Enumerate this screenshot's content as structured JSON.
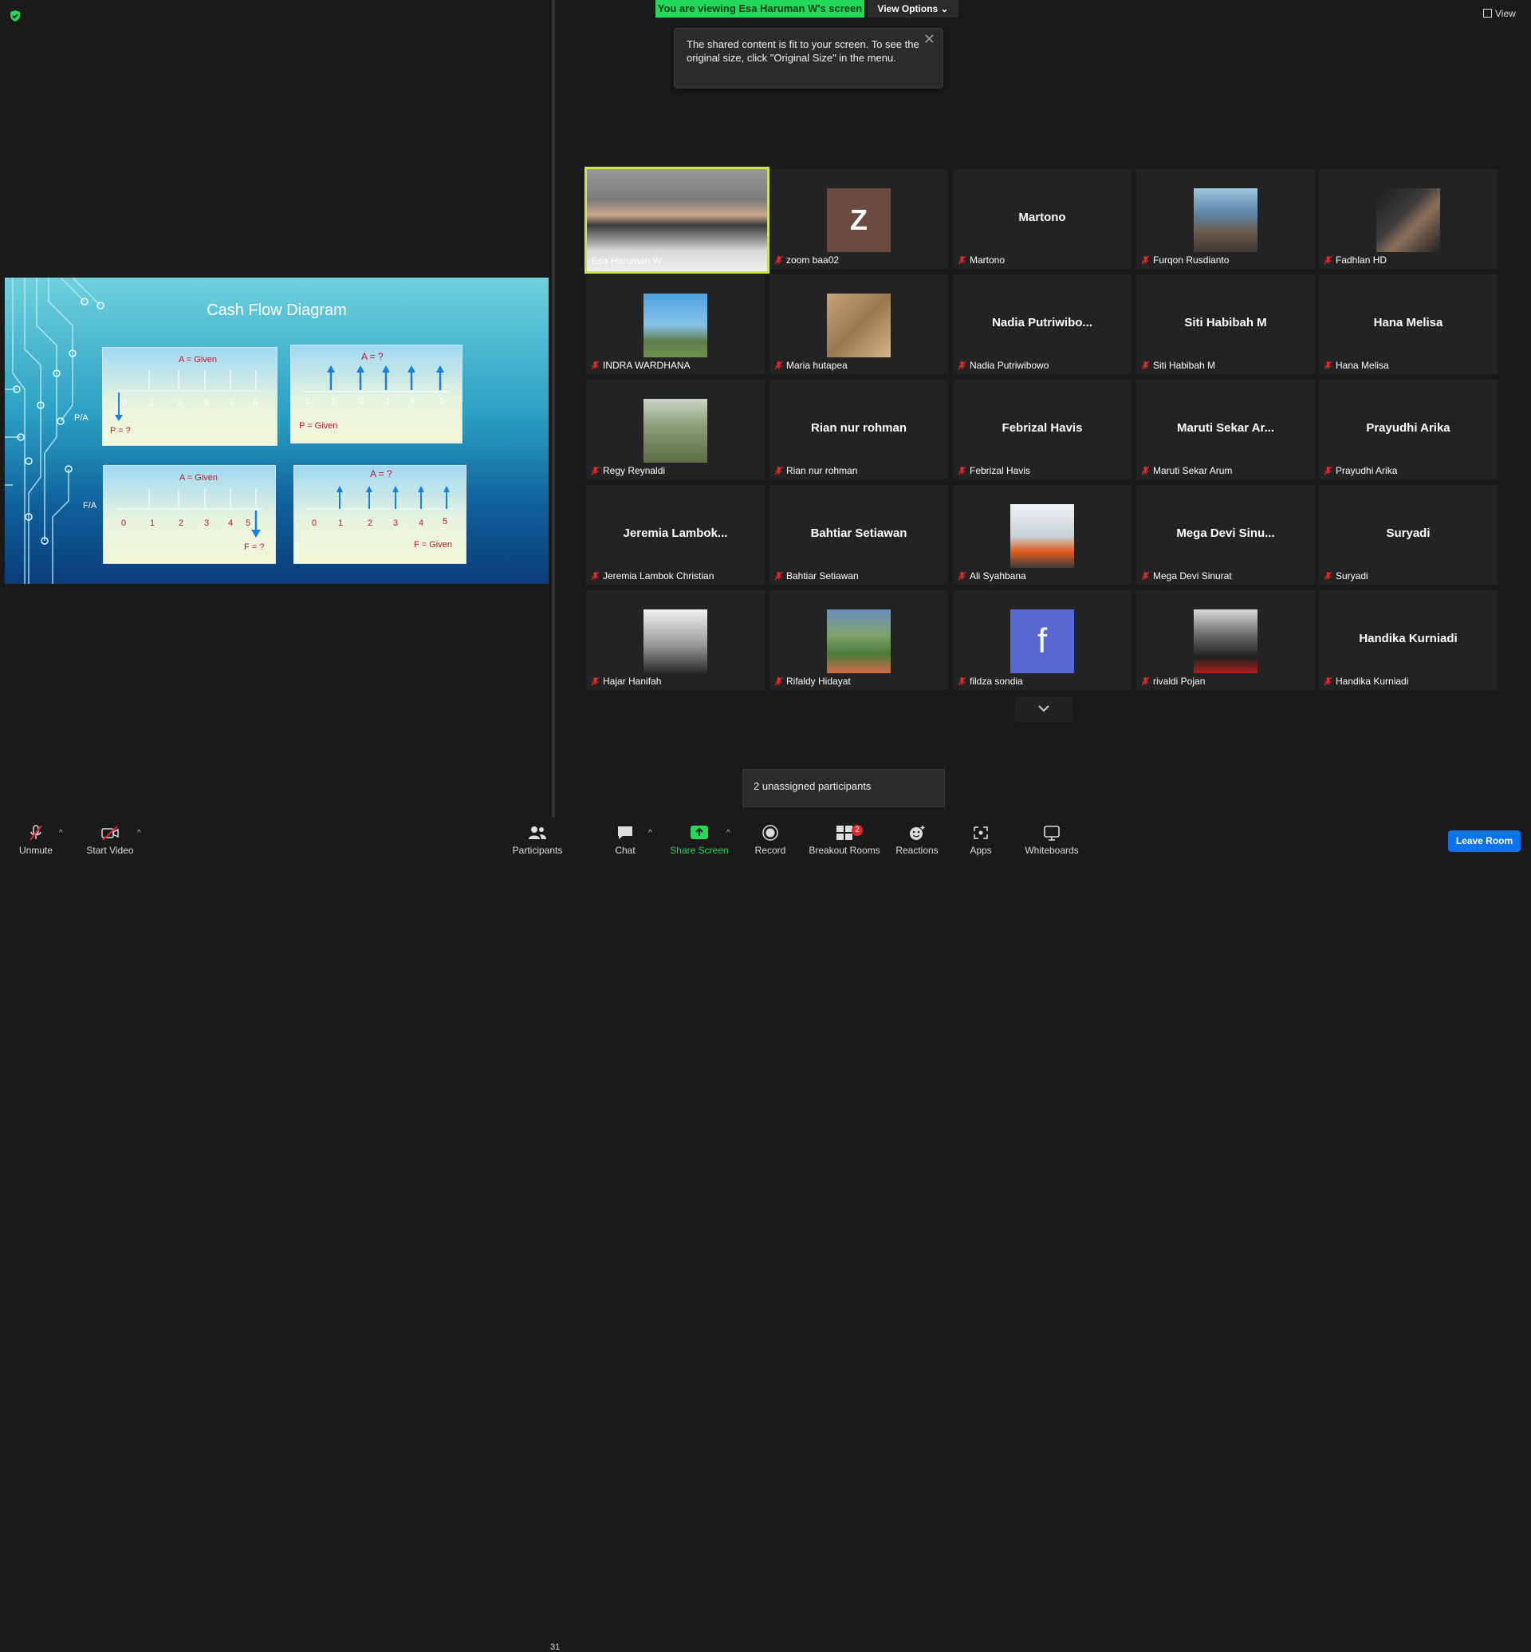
{
  "banner": {
    "text": "You are viewing Esa Haruman W's screen",
    "view_options": "View Options ⌄",
    "view": "View"
  },
  "tooltip": {
    "text": "The shared content is fit to your screen. To see the original size, click \"Original Size\" in the menu.",
    "close": "✕"
  },
  "slide": {
    "title": "Cash Flow Diagram",
    "panels": [
      {
        "top_label": "A = Given",
        "bottom_label": "P = ?",
        "side_label": "P/A",
        "ticks": [
          "0",
          "1",
          "2",
          "3",
          "4",
          "5"
        ]
      },
      {
        "top_label": "A = ?",
        "bottom_label": "P = Given",
        "ticks": [
          "0",
          "1",
          "2",
          "3",
          "4",
          "5"
        ]
      },
      {
        "top_label": "A = Given",
        "bottom_label": "F = ?",
        "side_label": "F/A",
        "ticks": [
          "0",
          "1",
          "2",
          "3",
          "4",
          "5"
        ]
      },
      {
        "top_label": "A = ?",
        "bottom_label": "F = Given",
        "ticks": [
          "0",
          "1",
          "2",
          "3",
          "4",
          "5"
        ]
      }
    ]
  },
  "participants": [
    {
      "label": "Esa Haruman W",
      "kind": "video"
    },
    {
      "label": "zoom baa02",
      "kind": "avatar",
      "initial": "Z"
    },
    {
      "label": "Martono",
      "kind": "name",
      "big": "Martono"
    },
    {
      "label": "Furqon Rusdianto",
      "kind": "photo"
    },
    {
      "label": "Fadhlan HD",
      "kind": "photo"
    },
    {
      "label": "INDRA WARDHANA",
      "kind": "photo"
    },
    {
      "label": "Maria hutapea",
      "kind": "photo"
    },
    {
      "label": "Nadia Putriwibowo",
      "kind": "name",
      "big": "Nadia  Putriwibo..."
    },
    {
      "label": "Siti Habibah M",
      "kind": "name",
      "big": "Siti Habibah M"
    },
    {
      "label": "Hana Melisa",
      "kind": "name",
      "big": "Hana Melisa"
    },
    {
      "label": "Regy Reynaldi",
      "kind": "photo"
    },
    {
      "label": "Rian nur rohman",
      "kind": "name",
      "big": "Rian nur rohman"
    },
    {
      "label": "Febrizal Havis",
      "kind": "name",
      "big": "Febrizal Havis"
    },
    {
      "label": "Maruti Sekar Arum",
      "kind": "name",
      "big": "Maruti  Sekar  Ar..."
    },
    {
      "label": "Prayudhi Arika",
      "kind": "name",
      "big": "Prayudhi Arika"
    },
    {
      "label": "Jeremia Lambok Christian",
      "kind": "name",
      "big": "Jeremia  Lambok..."
    },
    {
      "label": "Bahtiar Setiawan",
      "kind": "name",
      "big": "Bahtiar Setiawan"
    },
    {
      "label": "Ali Syahbana",
      "kind": "photo"
    },
    {
      "label": "Mega Devi Sinurat",
      "kind": "name",
      "big": "Mega  Devi  Sinu..."
    },
    {
      "label": "Suryadi",
      "kind": "name",
      "big": "Suryadi"
    },
    {
      "label": "Hajar Hanifah",
      "kind": "photo"
    },
    {
      "label": "Rifaldy Hidayat",
      "kind": "photo"
    },
    {
      "label": "fildza sondia",
      "kind": "avatar",
      "initial": "f"
    },
    {
      "label": "rivaldi Pojan",
      "kind": "photo"
    },
    {
      "label": "Handika Kurniadi",
      "kind": "name",
      "big": "Handika Kurniadi"
    }
  ],
  "unassigned": "2 unassigned participants",
  "toolbar": {
    "unmute": "Unmute",
    "start_video": "Start Video",
    "participants": "Participants",
    "participants_count": "31",
    "chat": "Chat",
    "share": "Share Screen",
    "record": "Record",
    "breakout": "Breakout Rooms",
    "breakout_badge": "2",
    "reactions": "Reactions",
    "apps": "Apps",
    "whiteboards": "Whiteboards",
    "leave": "Leave Room"
  },
  "colors": {
    "accent_green": "#23d959",
    "leave_blue": "#0e72ed",
    "active_border": "#cbe54f"
  }
}
